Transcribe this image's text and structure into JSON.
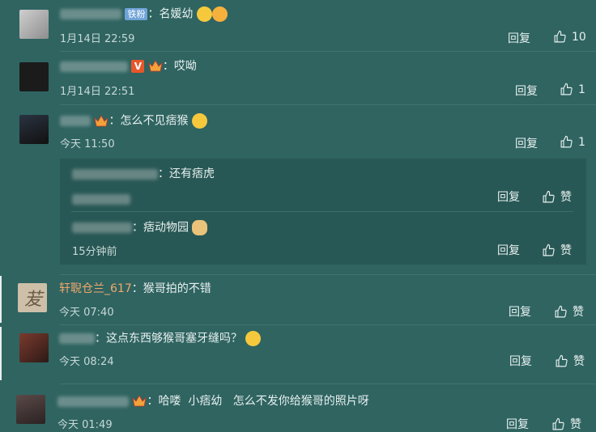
{
  "comments": [
    {
      "text": "名媛幼",
      "time": "1月14日 22:59",
      "reply": "回复",
      "likes": "10"
    },
    {
      "text": "哎呦",
      "time": "1月14日 22:51",
      "reply": "回复",
      "likes": "1"
    },
    {
      "text": "怎么不见痞猴",
      "time": "今天 11:50",
      "reply": "回复",
      "likes": "1"
    },
    {
      "username": "轩聣仓兰_617",
      "text": "猴哥拍的不错",
      "time": "今天 07:40",
      "reply": "回复",
      "likes": "赞"
    },
    {
      "text": "这点东西够猴哥塞牙缝吗？",
      "time": "今天 08:24",
      "reply": "回复",
      "likes": "赞"
    },
    {
      "text": "哈喽  小痞幼   怎么不发你给猴哥的照片呀",
      "time": "今天 01:49",
      "reply": "回复",
      "likes": "赞"
    }
  ],
  "replies": [
    {
      "text": "还有痞虎",
      "reply": "回复",
      "likes": "赞"
    },
    {
      "text": "痞动物园",
      "time": "15分钟前",
      "reply": "回复",
      "likes": "赞"
    }
  ],
  "badges": {
    "tiefen": "铁粉",
    "v": "V"
  },
  "colors": {
    "background": "#2f6461",
    "reply_box": "#285855",
    "username_link": "#f3a86c"
  }
}
